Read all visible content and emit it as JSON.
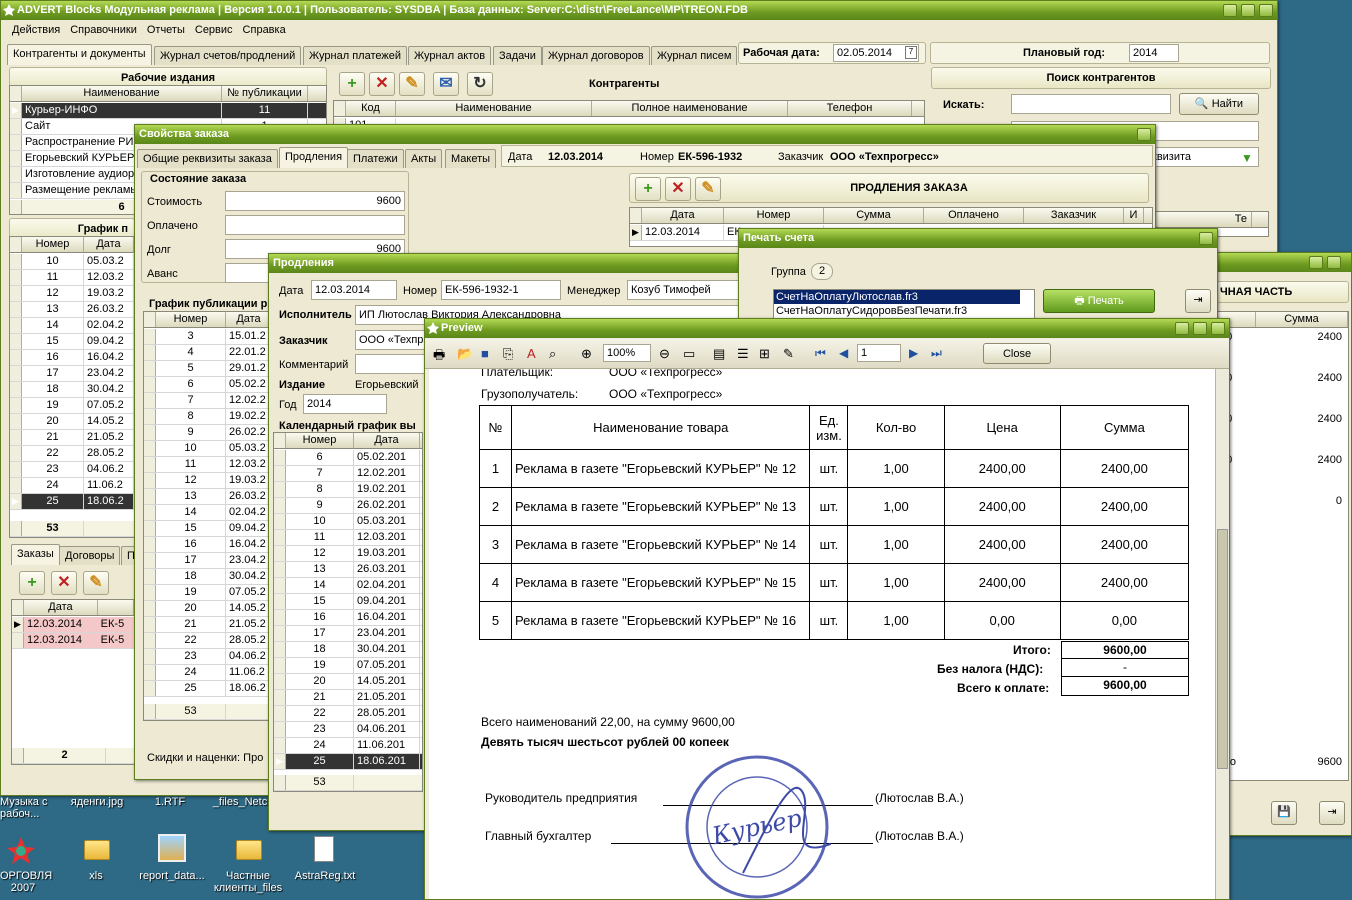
{
  "main": {
    "title": "ADVERT Blocks Модульная реклама | Версия 1.0.0.1 | Пользователь: SYSDBA | База данных: Server:C:\\distr\\FreeLance\\MP\\TREON.FDB",
    "menu": [
      "Действия",
      "Справочники",
      "Отчеты",
      "Сервис",
      "Справка"
    ],
    "tabs": [
      "Контрагенты и документы",
      "Журнал счетов/продлений",
      "Журнал платежей",
      "Журнал актов",
      "Задачи",
      "Журнал договоров",
      "Журнал писем"
    ],
    "work_date_label": "Рабочая дата:",
    "work_date": "02.05.2014",
    "plan_year_label": "Плановый год:",
    "plan_year": "2014",
    "editions_title": "Рабочие издания",
    "editions_cols": [
      "Наименование",
      "№ публикации"
    ],
    "editions": [
      {
        "name": "Курьер-ИНФО",
        "num": "11"
      },
      {
        "name": "Сайт",
        "num": "1"
      },
      {
        "name": "Распространение РИМ",
        "num": ""
      },
      {
        "name": "Егорьевский КУРЬЕР",
        "num": ""
      },
      {
        "name": "Изготовление аудиоро",
        "num": ""
      },
      {
        "name": "Размещение рекламы",
        "num": ""
      }
    ],
    "editions_total": "6",
    "schedule_title": "График п",
    "schedule_cols": [
      "Номер",
      "Дата"
    ],
    "schedule": [
      {
        "n": "10",
        "d": "05.03.2"
      },
      {
        "n": "11",
        "d": "12.03.2"
      },
      {
        "n": "12",
        "d": "19.03.2"
      },
      {
        "n": "13",
        "d": "26.03.2"
      },
      {
        "n": "14",
        "d": "02.04.2"
      },
      {
        "n": "15",
        "d": "09.04.2"
      },
      {
        "n": "16",
        "d": "16.04.2"
      },
      {
        "n": "17",
        "d": "23.04.2"
      },
      {
        "n": "18",
        "d": "30.04.2"
      },
      {
        "n": "19",
        "d": "07.05.2"
      },
      {
        "n": "20",
        "d": "14.05.2"
      },
      {
        "n": "21",
        "d": "21.05.2"
      },
      {
        "n": "22",
        "d": "28.05.2"
      },
      {
        "n": "23",
        "d": "04.06.2"
      },
      {
        "n": "24",
        "d": "11.06.2"
      },
      {
        "n": "25",
        "d": "18.06.2"
      }
    ],
    "schedule_total": "53",
    "bottom_tabs": [
      "Заказы",
      "Договоры",
      "П"
    ],
    "orders_cols": [
      "Дата",
      ""
    ],
    "orders": [
      {
        "d": "12.03.2014",
        "n": "ЕК-5"
      },
      {
        "d": "12.03.2014",
        "n": "ЕК-5"
      }
    ],
    "orders_total": "2",
    "contr_title": "Контрагенты",
    "contr_cols": [
      "Код",
      "Наименование",
      "Полное наименование",
      "Телефон"
    ],
    "contr_row_code": "101",
    "search_title": "Поиск контрагентов",
    "search_label": "Искать:",
    "search_btn": "Найти",
    "requisite_text": "квизита"
  },
  "order": {
    "title": "Свойства заказа",
    "tabs": [
      "Общие реквизиты заказа",
      "Продления",
      "Платежи",
      "Акты",
      "Макеты"
    ],
    "date_label": "Дата",
    "date": "12.03.2014",
    "number_label": "Номер",
    "number": "ЕК-596-1932",
    "customer_label": "Заказчик",
    "customer": "ООО «Техпрогресс»",
    "state_title": "Состояние заказа",
    "fields": [
      {
        "label": "Стоимость",
        "value": "9600"
      },
      {
        "label": "Оплачено",
        "value": ""
      },
      {
        "label": "Долг",
        "value": "9600"
      },
      {
        "label": "Аванс",
        "value": ""
      }
    ],
    "pub_title": "График публикации р",
    "pub_cols": [
      "Номер",
      "Дата"
    ],
    "pub": [
      {
        "n": "3",
        "d": "15.01.2"
      },
      {
        "n": "4",
        "d": "22.01.2"
      },
      {
        "n": "5",
        "d": "29.01.2"
      },
      {
        "n": "6",
        "d": "05.02.2"
      },
      {
        "n": "7",
        "d": "12.02.2"
      },
      {
        "n": "8",
        "d": "19.02.2"
      },
      {
        "n": "9",
        "d": "26.02.2"
      },
      {
        "n": "10",
        "d": "05.03.2"
      },
      {
        "n": "11",
        "d": "12.03.2"
      },
      {
        "n": "12",
        "d": "19.03.2"
      },
      {
        "n": "13",
        "d": "26.03.2"
      },
      {
        "n": "14",
        "d": "02.04.2"
      },
      {
        "n": "15",
        "d": "09.04.2"
      },
      {
        "n": "16",
        "d": "16.04.2"
      },
      {
        "n": "17",
        "d": "23.04.2"
      },
      {
        "n": "18",
        "d": "30.04.2"
      },
      {
        "n": "19",
        "d": "07.05.2"
      },
      {
        "n": "20",
        "d": "14.05.2"
      },
      {
        "n": "21",
        "d": "21.05.2"
      },
      {
        "n": "22",
        "d": "28.05.2"
      },
      {
        "n": "23",
        "d": "04.06.2"
      },
      {
        "n": "24",
        "d": "11.06.2"
      },
      {
        "n": "25",
        "d": "18.06.2"
      }
    ],
    "pub_total": "53",
    "ext_title": "ПРОДЛЕНИЯ ЗАКАЗА",
    "ext_cols": [
      "Дата",
      "Номер",
      "Сумма",
      "Оплачено",
      "Заказчик",
      "И"
    ],
    "ext_row": {
      "d": "12.03.2014",
      "n": "ЕК"
    },
    "discount": "Скидки и наценки: Про"
  },
  "ext": {
    "title": "Продления",
    "date_label": "Дата",
    "date": "12.03.2014",
    "num_label": "Номер",
    "num": "ЕК-596-1932-1",
    "mgr_label": "Менеджер",
    "mgr": "Козуб Тимофей",
    "exec_label": "Исполнитель",
    "exec": "ИП Лютослав Виктория Александровна",
    "cust_label": "Заказчик",
    "cust": "ООО «Техпр",
    "comment_label": "Комментарий",
    "edition_label": "Издание",
    "edition": "Егорьевский",
    "year_label": "Год",
    "year": "2014",
    "cal_title": "Календарный график вы",
    "cal_cols": [
      "Номер",
      "Дата"
    ],
    "cal": [
      {
        "n": "6",
        "d": "05.02.201"
      },
      {
        "n": "7",
        "d": "12.02.201"
      },
      {
        "n": "8",
        "d": "19.02.201"
      },
      {
        "n": "9",
        "d": "26.02.201"
      },
      {
        "n": "10",
        "d": "05.03.201"
      },
      {
        "n": "11",
        "d": "12.03.201"
      },
      {
        "n": "12",
        "d": "19.03.201"
      },
      {
        "n": "13",
        "d": "26.03.201"
      },
      {
        "n": "14",
        "d": "02.04.201"
      },
      {
        "n": "15",
        "d": "09.04.201"
      },
      {
        "n": "16",
        "d": "16.04.201"
      },
      {
        "n": "17",
        "d": "23.04.201"
      },
      {
        "n": "18",
        "d": "30.04.201"
      },
      {
        "n": "19",
        "d": "07.05.201"
      },
      {
        "n": "20",
        "d": "14.05.201"
      },
      {
        "n": "21",
        "d": "21.05.201"
      },
      {
        "n": "22",
        "d": "28.05.201"
      },
      {
        "n": "23",
        "d": "04.06.201"
      },
      {
        "n": "24",
        "d": "11.06.201"
      },
      {
        "n": "25",
        "d": "18.06.201"
      }
    ],
    "cal_total": "53"
  },
  "print": {
    "title": "Печать счета",
    "group_label": "Группа",
    "group": "2",
    "files": [
      "СчетНаОплатуЛютослав.fr3",
      "СчетНаОплатуСидоровБезПечати.fr3"
    ],
    "print_btn": "Печать"
  },
  "bgwin": {
    "title": "ЧНАЯ ЧАСТЬ",
    "col": "Сумма",
    "vals": [
      "2400",
      "2400",
      "2400",
      "2400",
      "0"
    ],
    "total": "9600",
    "left_frag": [
      "00",
      "00",
      "00",
      "00",
      "0"
    ],
    "left_total": "его"
  },
  "preview": {
    "title": "Preview",
    "zoom": "100%",
    "page": "1",
    "close": "Close",
    "payer_label": "Плательщик:",
    "payer": "ООО «Техпрогресс»",
    "consignee_label": "Грузополучатель:",
    "consignee": "ООО «Техпрогресс»",
    "cols": [
      "№",
      "Наименование товара",
      "Ед. изм.",
      "Кол-во",
      "Цена",
      "Сумма"
    ],
    "items": [
      {
        "n": "1",
        "name": "Реклама в газете \"Егорьевский КУРЬЕР\" № 12",
        "u": "шт.",
        "q": "1,00",
        "p": "2400,00",
        "s": "2400,00"
      },
      {
        "n": "2",
        "name": "Реклама в газете \"Егорьевский КУРЬЕР\" № 13",
        "u": "шт.",
        "q": "1,00",
        "p": "2400,00",
        "s": "2400,00"
      },
      {
        "n": "3",
        "name": "Реклама в газете \"Егорьевский КУРЬЕР\" № 14",
        "u": "шт.",
        "q": "1,00",
        "p": "2400,00",
        "s": "2400,00"
      },
      {
        "n": "4",
        "name": "Реклама в газете \"Егорьевский КУРЬЕР\" № 15",
        "u": "шт.",
        "q": "1,00",
        "p": "2400,00",
        "s": "2400,00"
      },
      {
        "n": "5",
        "name": "Реклама в газете \"Егорьевский КУРЬЕР\" № 16",
        "u": "шт.",
        "q": "1,00",
        "p": "0,00",
        "s": "0,00"
      }
    ],
    "total_label": "Итого:",
    "total": "9600,00",
    "vat_label": "Без налога (НДС):",
    "vat": "-",
    "due_label": "Всего к оплате:",
    "due": "9600,00",
    "summary": "Всего наименований 22,00, на сумму 9600,00",
    "words": "Девять тысяч шестьсот рублей  00 копеек",
    "head_label": "Руководитель предприятия",
    "head_name": "(Лютослав В.А.)",
    "acc_label": "Главный бухгалтер",
    "acc_name": "(Лютослав В.А.)",
    "stamp_word": "Курьер"
  },
  "desktop": [
    {
      "label": "Музыка с рабоч..."
    },
    {
      "label": "яденги.jpg"
    },
    {
      "label": "1.RTF"
    },
    {
      "label": "_files_Netc"
    },
    {
      "label": "ОРГОВЛЯ 2007"
    },
    {
      "label": "xls"
    },
    {
      "label": "report_data..."
    },
    {
      "label": "Частные клиенты_files"
    },
    {
      "label": "AstraReg.txt"
    }
  ]
}
